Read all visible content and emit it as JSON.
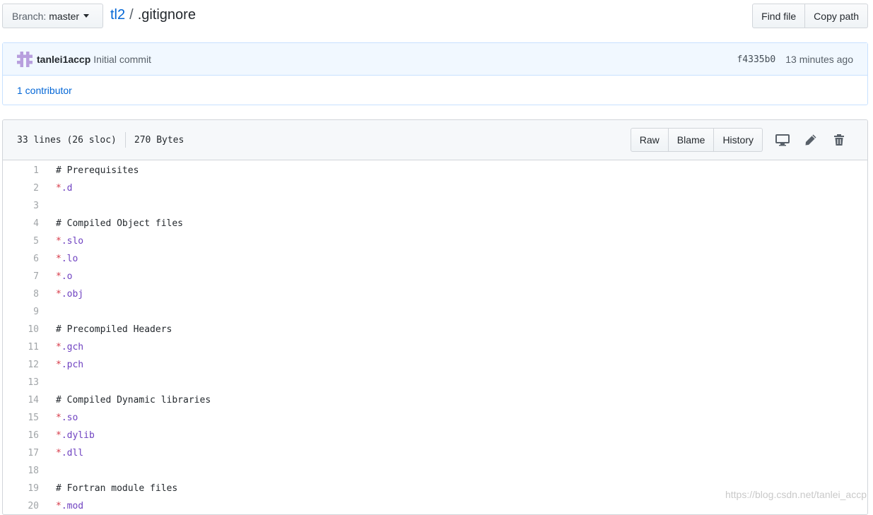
{
  "branch": {
    "label": "Branch:",
    "value": "master"
  },
  "breadcrumb": {
    "repo": "tl2",
    "separator": "/",
    "file": ".gitignore"
  },
  "file_nav_buttons": {
    "find_file": "Find file",
    "copy_path": "Copy path"
  },
  "commit": {
    "author": "tanlei1accp",
    "message": "Initial commit",
    "sha": "f4335b0",
    "time": "13 minutes ago",
    "avatar_color": "#b89fde"
  },
  "contributors": {
    "label": "1 contributor"
  },
  "file": {
    "lines_info": "33 lines (26 sloc)",
    "size": "270 Bytes",
    "buttons": {
      "raw": "Raw",
      "blame": "Blame",
      "history": "History"
    },
    "icons": [
      "desktop-icon",
      "pencil-icon",
      "trash-icon"
    ]
  },
  "code_lines": [
    {
      "n": "1",
      "type": "comment",
      "text": "# Prerequisites"
    },
    {
      "n": "2",
      "type": "pattern",
      "star": "*",
      "rest": ".d"
    },
    {
      "n": "3",
      "type": "blank",
      "text": ""
    },
    {
      "n": "4",
      "type": "comment",
      "text": "# Compiled Object files"
    },
    {
      "n": "5",
      "type": "pattern",
      "star": "*",
      "rest": ".slo"
    },
    {
      "n": "6",
      "type": "pattern",
      "star": "*",
      "rest": ".lo"
    },
    {
      "n": "7",
      "type": "pattern",
      "star": "*",
      "rest": ".o"
    },
    {
      "n": "8",
      "type": "pattern",
      "star": "*",
      "rest": ".obj"
    },
    {
      "n": "9",
      "type": "blank",
      "text": ""
    },
    {
      "n": "10",
      "type": "comment",
      "text": "# Precompiled Headers"
    },
    {
      "n": "11",
      "type": "pattern",
      "star": "*",
      "rest": ".gch"
    },
    {
      "n": "12",
      "type": "pattern",
      "star": "*",
      "rest": ".pch"
    },
    {
      "n": "13",
      "type": "blank",
      "text": ""
    },
    {
      "n": "14",
      "type": "comment",
      "text": "# Compiled Dynamic libraries"
    },
    {
      "n": "15",
      "type": "pattern",
      "star": "*",
      "rest": ".so"
    },
    {
      "n": "16",
      "type": "pattern",
      "star": "*",
      "rest": ".dylib"
    },
    {
      "n": "17",
      "type": "pattern",
      "star": "*",
      "rest": ".dll"
    },
    {
      "n": "18",
      "type": "blank",
      "text": ""
    },
    {
      "n": "19",
      "type": "comment",
      "text": "# Fortran module files"
    },
    {
      "n": "20",
      "type": "pattern",
      "star": "*",
      "rest": ".mod"
    }
  ],
  "watermark": "https://blog.csdn.net/tanlei_accp"
}
